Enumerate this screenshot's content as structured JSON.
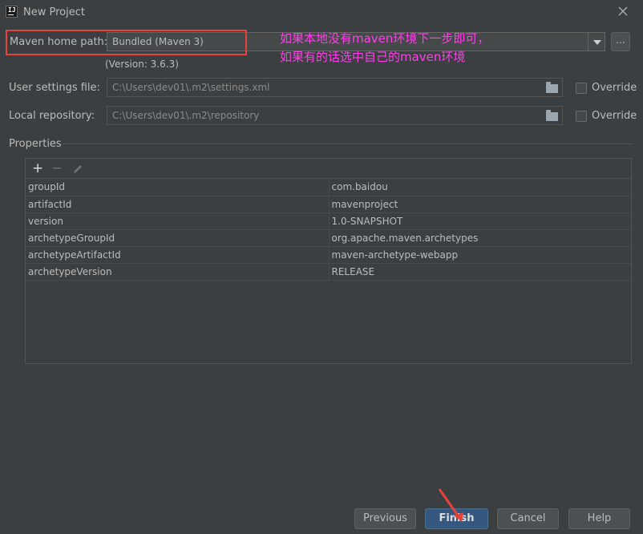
{
  "window": {
    "title": "New Project"
  },
  "maven_home": {
    "label": "Maven home path:",
    "value": "Bundled (Maven 3)",
    "version": "(Version: 3.6.3)",
    "browse_label": "..."
  },
  "user_settings": {
    "label": "User settings file:",
    "value": "C:\\Users\\dev01\\.m2\\settings.xml",
    "override_label": "Override"
  },
  "local_repo": {
    "label": "Local repository:",
    "value": "C:\\Users\\dev01\\.m2\\repository",
    "override_label": "Override"
  },
  "annotation": {
    "line1": "如果本地没有maven环境下一步即可，",
    "line2": "如果有的话选中自己的maven环境",
    "color": "#ff3ee8"
  },
  "properties": {
    "label": "Properties",
    "toolbar": {
      "add": "+",
      "remove": "−"
    },
    "rows": [
      {
        "key": "groupId",
        "value": "com.baidou"
      },
      {
        "key": "artifactId",
        "value": "mavenproject"
      },
      {
        "key": "version",
        "value": "1.0-SNAPSHOT"
      },
      {
        "key": "archetypeGroupId",
        "value": "org.apache.maven.archetypes"
      },
      {
        "key": "archetypeArtifactId",
        "value": "maven-archetype-webapp"
      },
      {
        "key": "archetypeVersion",
        "value": "RELEASE"
      }
    ]
  },
  "buttons": {
    "previous": "Previous",
    "finish": "Finish",
    "cancel": "Cancel",
    "help": "Help"
  },
  "colors": {
    "background": "#3c3f41",
    "highlight_box": "#e8433b",
    "primary_button": "#365880"
  }
}
